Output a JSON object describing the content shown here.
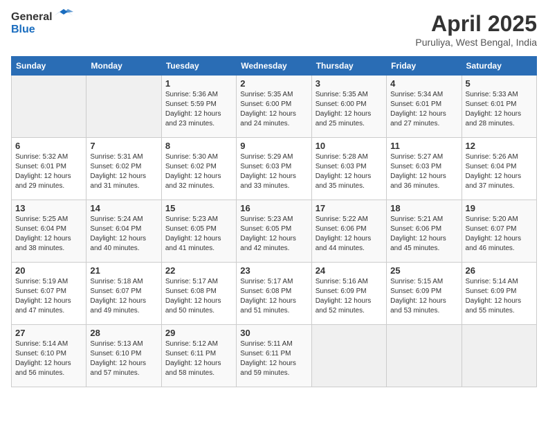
{
  "header": {
    "logo_line1": "General",
    "logo_line2": "Blue",
    "title": "April 2025",
    "subtitle": "Puruliya, West Bengal, India"
  },
  "days_of_week": [
    "Sunday",
    "Monday",
    "Tuesday",
    "Wednesday",
    "Thursday",
    "Friday",
    "Saturday"
  ],
  "weeks": [
    [
      {
        "day": "",
        "empty": true
      },
      {
        "day": "",
        "empty": true
      },
      {
        "day": "1",
        "sunrise": "Sunrise: 5:36 AM",
        "sunset": "Sunset: 5:59 PM",
        "daylight": "Daylight: 12 hours and 23 minutes."
      },
      {
        "day": "2",
        "sunrise": "Sunrise: 5:35 AM",
        "sunset": "Sunset: 6:00 PM",
        "daylight": "Daylight: 12 hours and 24 minutes."
      },
      {
        "day": "3",
        "sunrise": "Sunrise: 5:35 AM",
        "sunset": "Sunset: 6:00 PM",
        "daylight": "Daylight: 12 hours and 25 minutes."
      },
      {
        "day": "4",
        "sunrise": "Sunrise: 5:34 AM",
        "sunset": "Sunset: 6:01 PM",
        "daylight": "Daylight: 12 hours and 27 minutes."
      },
      {
        "day": "5",
        "sunrise": "Sunrise: 5:33 AM",
        "sunset": "Sunset: 6:01 PM",
        "daylight": "Daylight: 12 hours and 28 minutes."
      }
    ],
    [
      {
        "day": "6",
        "sunrise": "Sunrise: 5:32 AM",
        "sunset": "Sunset: 6:01 PM",
        "daylight": "Daylight: 12 hours and 29 minutes."
      },
      {
        "day": "7",
        "sunrise": "Sunrise: 5:31 AM",
        "sunset": "Sunset: 6:02 PM",
        "daylight": "Daylight: 12 hours and 31 minutes."
      },
      {
        "day": "8",
        "sunrise": "Sunrise: 5:30 AM",
        "sunset": "Sunset: 6:02 PM",
        "daylight": "Daylight: 12 hours and 32 minutes."
      },
      {
        "day": "9",
        "sunrise": "Sunrise: 5:29 AM",
        "sunset": "Sunset: 6:03 PM",
        "daylight": "Daylight: 12 hours and 33 minutes."
      },
      {
        "day": "10",
        "sunrise": "Sunrise: 5:28 AM",
        "sunset": "Sunset: 6:03 PM",
        "daylight": "Daylight: 12 hours and 35 minutes."
      },
      {
        "day": "11",
        "sunrise": "Sunrise: 5:27 AM",
        "sunset": "Sunset: 6:03 PM",
        "daylight": "Daylight: 12 hours and 36 minutes."
      },
      {
        "day": "12",
        "sunrise": "Sunrise: 5:26 AM",
        "sunset": "Sunset: 6:04 PM",
        "daylight": "Daylight: 12 hours and 37 minutes."
      }
    ],
    [
      {
        "day": "13",
        "sunrise": "Sunrise: 5:25 AM",
        "sunset": "Sunset: 6:04 PM",
        "daylight": "Daylight: 12 hours and 38 minutes."
      },
      {
        "day": "14",
        "sunrise": "Sunrise: 5:24 AM",
        "sunset": "Sunset: 6:04 PM",
        "daylight": "Daylight: 12 hours and 40 minutes."
      },
      {
        "day": "15",
        "sunrise": "Sunrise: 5:23 AM",
        "sunset": "Sunset: 6:05 PM",
        "daylight": "Daylight: 12 hours and 41 minutes."
      },
      {
        "day": "16",
        "sunrise": "Sunrise: 5:23 AM",
        "sunset": "Sunset: 6:05 PM",
        "daylight": "Daylight: 12 hours and 42 minutes."
      },
      {
        "day": "17",
        "sunrise": "Sunrise: 5:22 AM",
        "sunset": "Sunset: 6:06 PM",
        "daylight": "Daylight: 12 hours and 44 minutes."
      },
      {
        "day": "18",
        "sunrise": "Sunrise: 5:21 AM",
        "sunset": "Sunset: 6:06 PM",
        "daylight": "Daylight: 12 hours and 45 minutes."
      },
      {
        "day": "19",
        "sunrise": "Sunrise: 5:20 AM",
        "sunset": "Sunset: 6:07 PM",
        "daylight": "Daylight: 12 hours and 46 minutes."
      }
    ],
    [
      {
        "day": "20",
        "sunrise": "Sunrise: 5:19 AM",
        "sunset": "Sunset: 6:07 PM",
        "daylight": "Daylight: 12 hours and 47 minutes."
      },
      {
        "day": "21",
        "sunrise": "Sunrise: 5:18 AM",
        "sunset": "Sunset: 6:07 PM",
        "daylight": "Daylight: 12 hours and 49 minutes."
      },
      {
        "day": "22",
        "sunrise": "Sunrise: 5:17 AM",
        "sunset": "Sunset: 6:08 PM",
        "daylight": "Daylight: 12 hours and 50 minutes."
      },
      {
        "day": "23",
        "sunrise": "Sunrise: 5:17 AM",
        "sunset": "Sunset: 6:08 PM",
        "daylight": "Daylight: 12 hours and 51 minutes."
      },
      {
        "day": "24",
        "sunrise": "Sunrise: 5:16 AM",
        "sunset": "Sunset: 6:09 PM",
        "daylight": "Daylight: 12 hours and 52 minutes."
      },
      {
        "day": "25",
        "sunrise": "Sunrise: 5:15 AM",
        "sunset": "Sunset: 6:09 PM",
        "daylight": "Daylight: 12 hours and 53 minutes."
      },
      {
        "day": "26",
        "sunrise": "Sunrise: 5:14 AM",
        "sunset": "Sunset: 6:09 PM",
        "daylight": "Daylight: 12 hours and 55 minutes."
      }
    ],
    [
      {
        "day": "27",
        "sunrise": "Sunrise: 5:14 AM",
        "sunset": "Sunset: 6:10 PM",
        "daylight": "Daylight: 12 hours and 56 minutes."
      },
      {
        "day": "28",
        "sunrise": "Sunrise: 5:13 AM",
        "sunset": "Sunset: 6:10 PM",
        "daylight": "Daylight: 12 hours and 57 minutes."
      },
      {
        "day": "29",
        "sunrise": "Sunrise: 5:12 AM",
        "sunset": "Sunset: 6:11 PM",
        "daylight": "Daylight: 12 hours and 58 minutes."
      },
      {
        "day": "30",
        "sunrise": "Sunrise: 5:11 AM",
        "sunset": "Sunset: 6:11 PM",
        "daylight": "Daylight: 12 hours and 59 minutes."
      },
      {
        "day": "",
        "empty": true
      },
      {
        "day": "",
        "empty": true
      },
      {
        "day": "",
        "empty": true
      }
    ]
  ]
}
